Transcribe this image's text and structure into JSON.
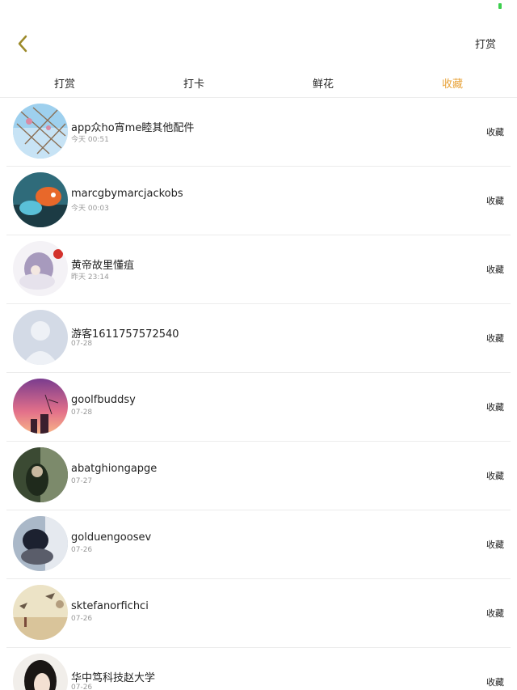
{
  "nav": {
    "back_icon": "chevron-left-icon",
    "right_label": "打赏",
    "accent_color": "#e8a33a"
  },
  "tabs": [
    {
      "label": "打赏",
      "active": false
    },
    {
      "label": "打卡",
      "active": false
    },
    {
      "label": "鲜花",
      "active": false
    },
    {
      "label": "收藏",
      "active": true
    }
  ],
  "list": {
    "items": [
      {
        "name": "app众ho宵me睦其他配件",
        "time": "今天 00:51",
        "action": "收藏"
      },
      {
        "name": "marcgbymarcjackobs",
        "time": "今天 00:03",
        "action": "收藏"
      },
      {
        "name": "黄帝故里懂疽",
        "time": "昨天 23:14",
        "action": "收藏"
      },
      {
        "name": "游客1611757572540",
        "time": "07-28",
        "action": "收藏"
      },
      {
        "name": "goolfbuddsy",
        "time": "07-28",
        "action": "收藏"
      },
      {
        "name": "abatghiongapge",
        "time": "07-27",
        "action": "收藏"
      },
      {
        "name": "golduengoosev",
        "time": "07-26",
        "action": "收藏"
      },
      {
        "name": "sktefanorfichci",
        "time": "07-26",
        "action": "收藏"
      },
      {
        "name": "华中笃科技赵大学",
        "time": "07-26",
        "action": "收藏"
      }
    ]
  }
}
